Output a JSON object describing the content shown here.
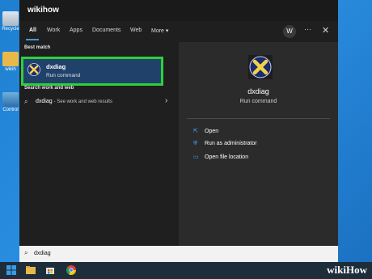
{
  "desktop": {
    "icons": [
      {
        "label": "Recycle",
        "icon": "recycle-bin-icon"
      },
      {
        "label": "wikih",
        "icon": "folder-icon"
      },
      {
        "label": "Control",
        "icon": "control-panel-icon"
      }
    ]
  },
  "search_panel": {
    "title": "wikihow",
    "tabs": [
      {
        "label": "All",
        "active": true
      },
      {
        "label": "Work"
      },
      {
        "label": "Apps"
      },
      {
        "label": "Documents"
      },
      {
        "label": "Web"
      },
      {
        "label": "More ▾"
      }
    ],
    "avatar_initial": "W",
    "ellipsis": "···",
    "close": "✕",
    "best_match_heading": "Best match",
    "best_match": {
      "name": "dxdiag",
      "subtitle": "Run command",
      "icon": "dxdiag-icon"
    },
    "web_heading": "Search work and web",
    "web_result": {
      "query": "dxdiag",
      "suffix": "- See work and web results"
    },
    "preview": {
      "name": "dxdiag",
      "subtitle": "Run command",
      "actions": [
        {
          "label": "Open",
          "icon": "open-icon"
        },
        {
          "label": "Run as administrator",
          "icon": "shield-icon"
        },
        {
          "label": "Open file location",
          "icon": "file-location-icon"
        }
      ]
    }
  },
  "searchbar": {
    "query": "dxdiag"
  },
  "taskbar": {
    "items": [
      "windows-start-icon",
      "search-icon",
      "file-explorer-icon",
      "store-icon",
      "chrome-icon"
    ]
  },
  "watermark": "wikiHow",
  "colors": {
    "highlight_border": "#2ed03a",
    "selection_bg": "#20416a",
    "accent": "#3a9be6"
  }
}
